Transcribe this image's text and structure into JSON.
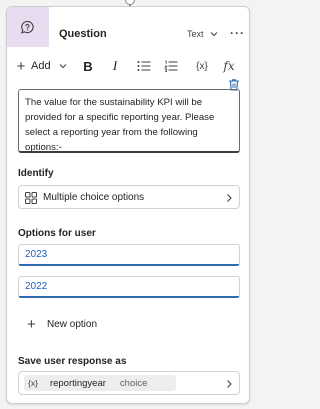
{
  "header": {
    "title": "Question",
    "type_label": "Text",
    "icon": "question-bubble-icon",
    "more_label": "···"
  },
  "toolbar": {
    "add_label": "Add",
    "bold_label": "B",
    "italic_label": "I",
    "variable_label": "{x}",
    "formula_label": "fx"
  },
  "message": {
    "text": "The value for the sustainability KPI will be provided for a specific reporting year. Please select a reporting year from the following options:-"
  },
  "identify": {
    "label": "Identify",
    "value": "Multiple choice options"
  },
  "options": {
    "label": "Options for user",
    "items": [
      "2023",
      "2022"
    ],
    "new_option_label": "New option"
  },
  "save": {
    "label": "Save user response as",
    "variable_prefix": "{x}",
    "variable_name": "reportingyear",
    "variable_type": "choice"
  },
  "colors": {
    "header_icon_bg": "#eadcf0",
    "accent_blue": "#2b6cb0",
    "option_text": "#1f5fbf"
  }
}
